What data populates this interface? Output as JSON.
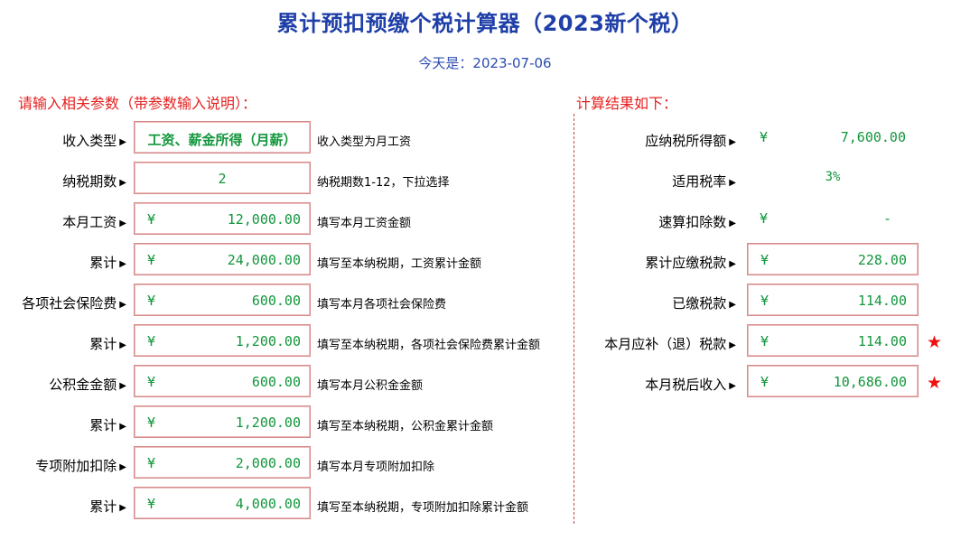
{
  "title": "累计预扣预缴个税计算器（2023新个税）",
  "date_line": "今天是：2023-07-06",
  "left_section_label": "请输入相关参数（带参数输入说明）：",
  "right_section_label": "计算结果如下：",
  "currency_symbol": "¥",
  "colors": {
    "title": "#1f3fa8",
    "section_label": "#e62020",
    "value": "#12963c",
    "box_border": "#d68a8a",
    "star": "#ee1111"
  },
  "inputs": [
    {
      "label": "收入类型",
      "value": "工资、薪金所得（月薪）",
      "description": "收入类型为月工资"
    },
    {
      "label": "纳税期数",
      "value": "2",
      "description": "纳税期数1-12，下拉选择"
    },
    {
      "label": "本月工资",
      "value": "12,000.00",
      "description": "填写本月工资金额"
    },
    {
      "label": "累计",
      "value": "24,000.00",
      "description": "填写至本纳税期，工资累计金额"
    },
    {
      "label": "各项社会保险费",
      "value": "600.00",
      "description": "填写本月各项社会保险费"
    },
    {
      "label": "累计",
      "value": "1,200.00",
      "description": "填写至本纳税期，各项社会保险费累计金额"
    },
    {
      "label": "公积金金额",
      "value": "600.00",
      "description": "填写本月公积金金额"
    },
    {
      "label": "累计",
      "value": "1,200.00",
      "description": "填写至本纳税期，公积金累计金额"
    },
    {
      "label": "专项附加扣除",
      "value": "2,000.00",
      "description": "填写本月专项附加扣除"
    },
    {
      "label": "累计",
      "value": "4,000.00",
      "description": "填写至本纳税期，专项附加扣除累计金额"
    }
  ],
  "results": [
    {
      "label": "应纳税所得额",
      "value": "7,600.00"
    },
    {
      "label": "适用税率",
      "value": "3%"
    },
    {
      "label": "速算扣除数",
      "value": "-"
    },
    {
      "label": "累计应缴税款",
      "value": "228.00"
    },
    {
      "label": "已缴税款",
      "value": "114.00"
    },
    {
      "label": "本月应补（退）税款",
      "value": "114.00",
      "star": "★"
    },
    {
      "label": "本月税后收入",
      "value": "10,686.00",
      "star": "★"
    }
  ]
}
